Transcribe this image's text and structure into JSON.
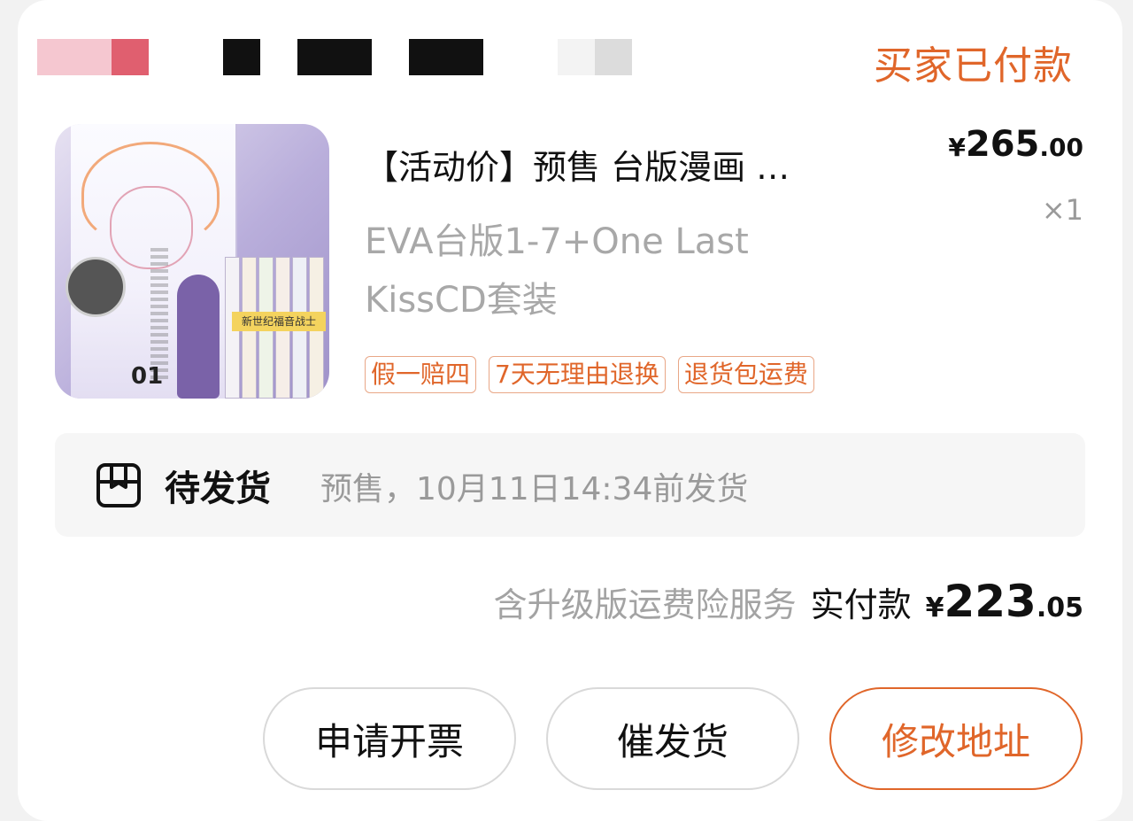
{
  "order": {
    "status": "买家已付款",
    "redacted_shop_name_colors": [
      "#f5c7d0",
      "#e05f6f",
      "#111111",
      "#111111",
      "#111111",
      "#f3f3f3",
      "#dcdcdc"
    ]
  },
  "product": {
    "thumbnail": {
      "alt": "EVA台版漫画套装封面",
      "volume_label": "01",
      "band_text": "新世纪福音战士"
    },
    "title": "【活动价】预售 台版漫画 …",
    "price": {
      "currency": "¥",
      "integer": "265",
      "decimal": ".00"
    },
    "quantity": "×1",
    "variant": "EVA台版1-7+One Last KissCD套装",
    "tags": [
      "假一赔四",
      "7天无理由退换",
      "退货包运费"
    ]
  },
  "shipping": {
    "icon": "package-icon",
    "status": "待发货",
    "description": "预售，10月11日14:34前发货"
  },
  "payment": {
    "note": "含升级版运费险服务",
    "label": "实付款",
    "amount": {
      "currency": "¥",
      "integer": "223",
      "decimal": ".05"
    }
  },
  "actions": {
    "invoice": "申请开票",
    "urge": "催发货",
    "edit_address": "修改地址"
  },
  "colors": {
    "accent": "#e0662a",
    "muted_text": "#a3a3a3",
    "card_bg": "#ffffff"
  }
}
